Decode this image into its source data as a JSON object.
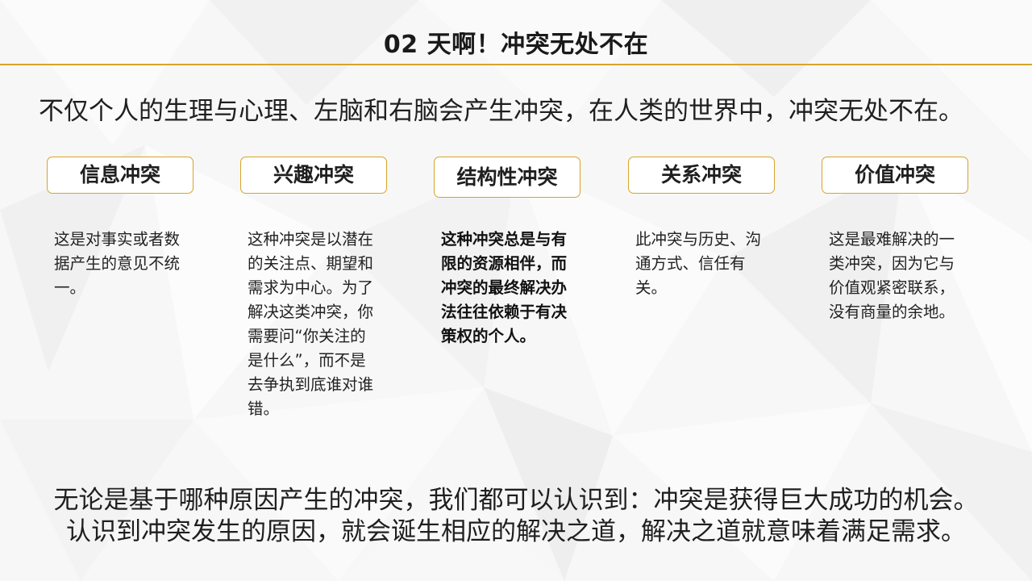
{
  "slide": {
    "title": "02 天啊！冲突无处不在",
    "intro": "不仅个人的生理与心理、左脑和右脑会产生冲突，在人类的世界中，冲突无处不在。",
    "categories": [
      {
        "label": "信息冲突",
        "text": "这是对事实或者数据产生的意见不统一。"
      },
      {
        "label": "兴趣冲突",
        "text": "这种冲突是以潜在的关注点、期望和需求为中心。为了解决这类冲突，你需要问“你关注的是什么”，而不是去争执到底谁对谁错。"
      },
      {
        "label": "结构性冲突",
        "text": "这种冲突总是与有限的资源相伴，而冲突的最终解决办法往往依赖于有决策权的个人。"
      },
      {
        "label": "关系冲突",
        "text": "此冲突与历史、沟通方式、信任有关。"
      },
      {
        "label": "价值冲突",
        "text": "这是最难解决的一类冲突，因为它与价值观紧密联系，没有商量的余地。"
      }
    ],
    "conclusion": [
      "无论是基于哪种原因产生的冲突，我们都可以认识到：冲突是获得巨大成功的机会。",
      "认识到冲突发生的原因，就会诞生相应的解决之道，解决之道就意味着满足需求。"
    ],
    "colors": {
      "accent": "#d6a42a",
      "background": "#f7f7f7",
      "text": "#1f1f1f"
    }
  }
}
